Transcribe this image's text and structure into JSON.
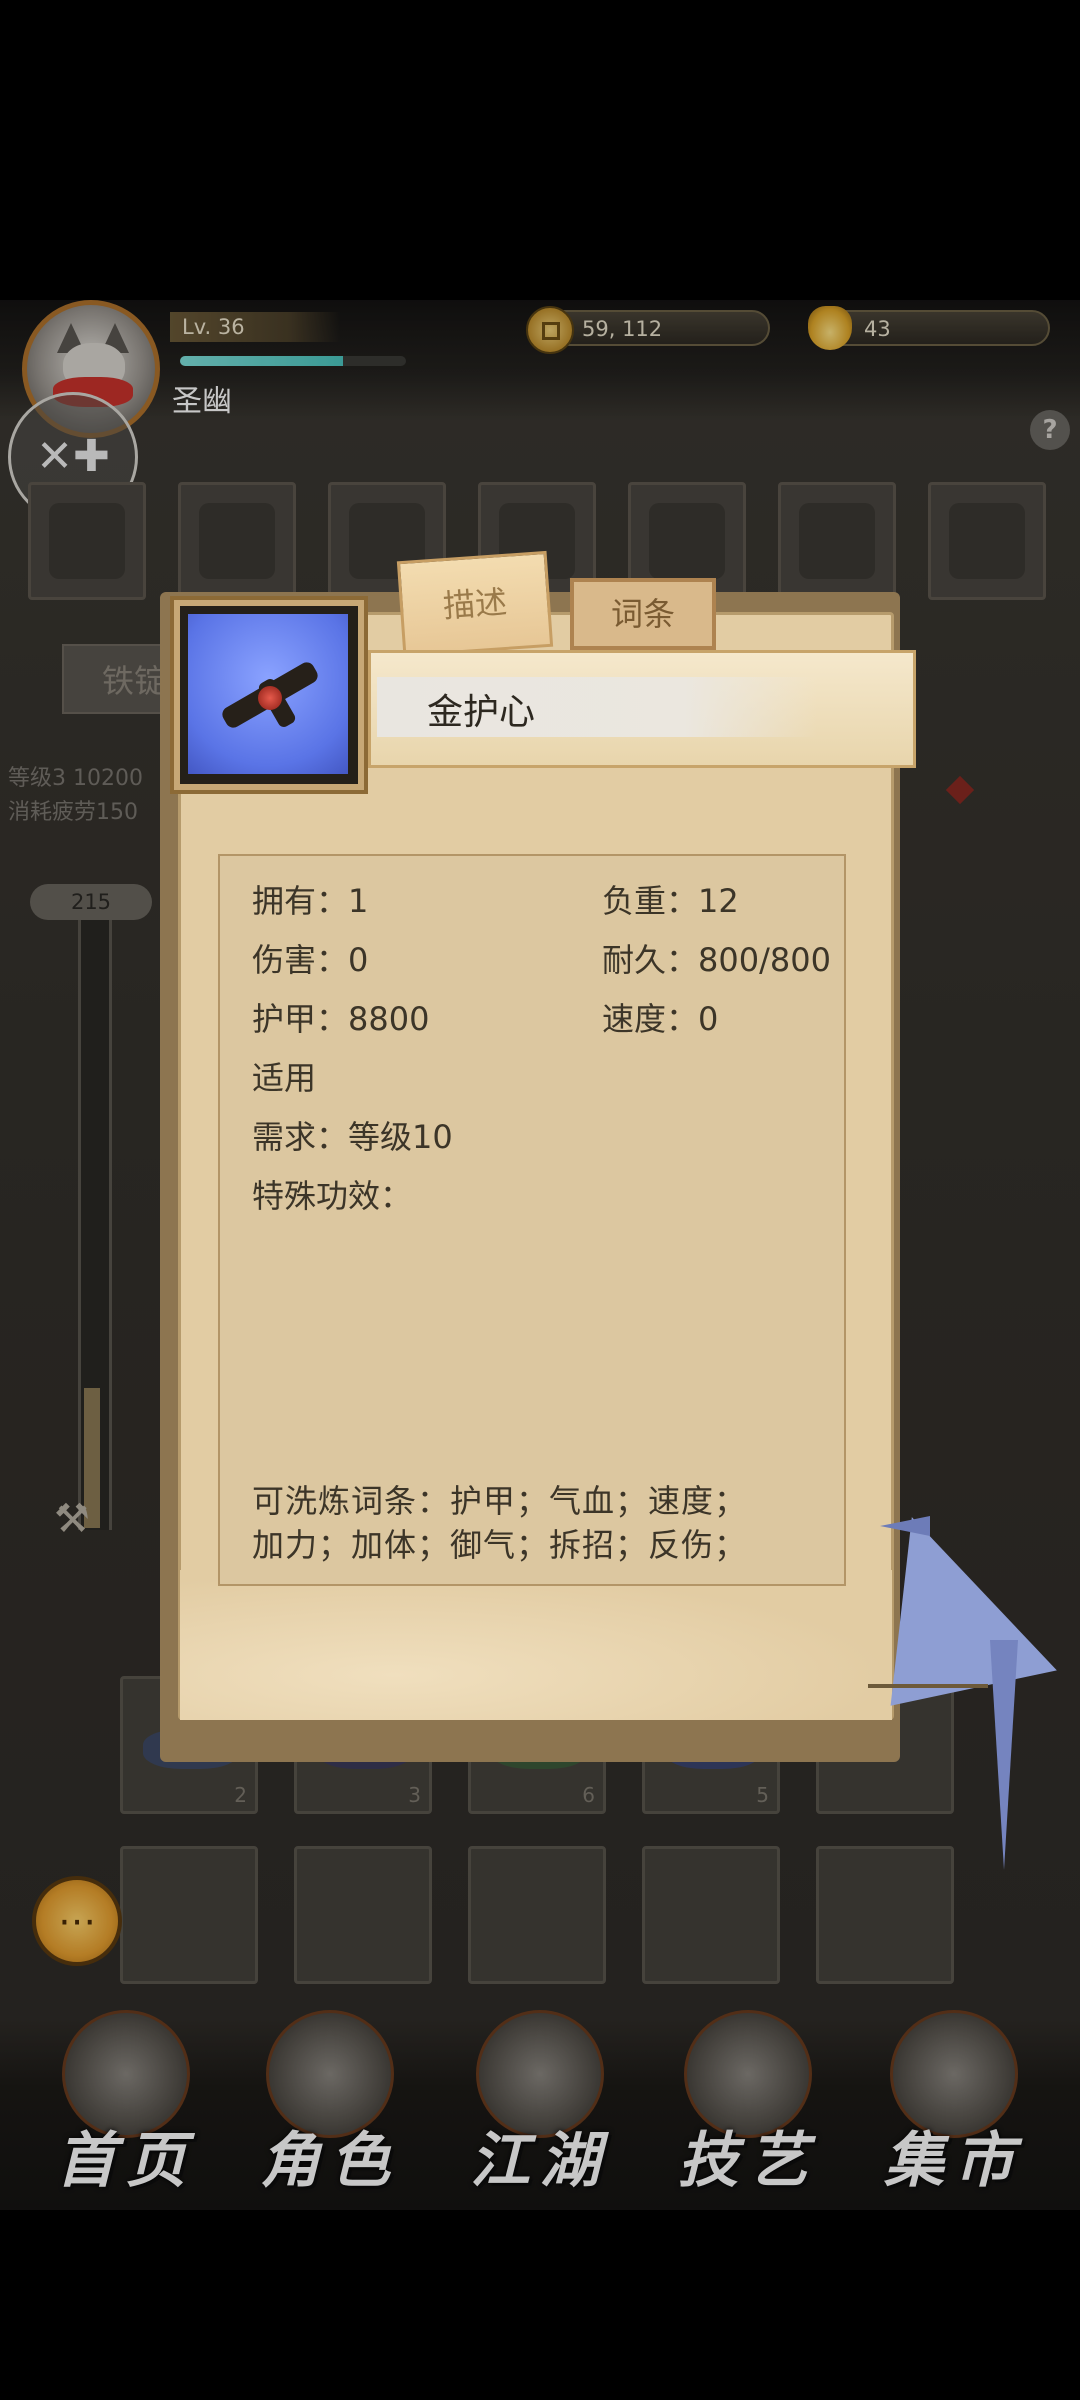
{
  "header": {
    "player_name": "圣幽",
    "level": "Lv. 36",
    "exp_fraction": 0.72,
    "coins": "59, 112",
    "gold_ingots": "43",
    "help_glyph": "?"
  },
  "background": {
    "left_tag": "铁锭",
    "stat_line1": "等级3    10200",
    "stat_line2": "消耗疲劳150",
    "slider_value": "215",
    "inventory_counts": [
      "2",
      "3",
      "6",
      "5"
    ]
  },
  "dialog": {
    "tabs": [
      {
        "label": "描述",
        "active": true
      },
      {
        "label": "词条",
        "active": false
      }
    ],
    "item_name": "金护心",
    "stats": {
      "owned": "拥有：1",
      "weight": "负重：12",
      "damage": "伤害：0",
      "durability": "耐久：800/800",
      "armor": "护甲：8800",
      "speed": "速度：0",
      "applicable": "适用",
      "requirement": "需求：等级10",
      "special_effect": "特殊功效："
    },
    "reroll_line1": "可洗炼词条：护甲；气血；速度；",
    "reroll_line2": "加力；加体；御气；拆招；反伤；"
  },
  "nav": [
    {
      "label": "首页",
      "icon": "home-icon"
    },
    {
      "label": "角色",
      "icon": "character-icon"
    },
    {
      "label": "江湖",
      "icon": "jianghu-icon"
    },
    {
      "label": "技艺",
      "icon": "skill-icon"
    },
    {
      "label": "集市",
      "icon": "market-icon"
    }
  ],
  "colors": {
    "parchment": "#e2cca3",
    "exp_bar": "#4cc6c0",
    "item_bg": "#5a74e6"
  }
}
